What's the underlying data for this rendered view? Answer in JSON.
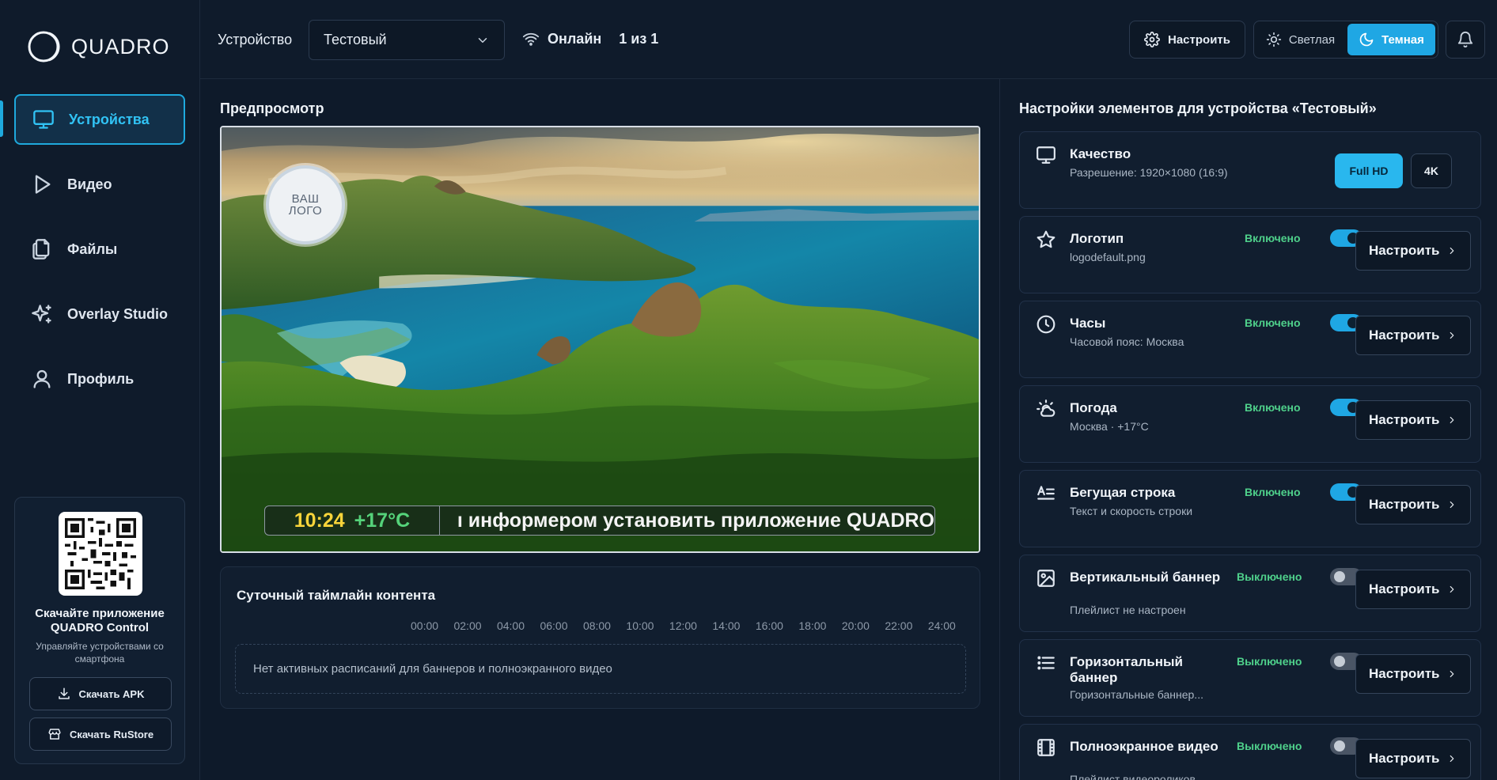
{
  "brand": {
    "name": "QUADRO"
  },
  "sidebar": {
    "items": [
      {
        "label": "Устройства",
        "icon": "monitor-icon",
        "active": true
      },
      {
        "label": "Видео",
        "icon": "play-icon",
        "active": false
      },
      {
        "label": "Файлы",
        "icon": "files-icon",
        "active": false
      },
      {
        "label": "Overlay Studio",
        "icon": "sparkles-icon",
        "active": false
      },
      {
        "label": "Профиль",
        "icon": "user-icon",
        "active": false
      }
    ],
    "app_card": {
      "title": "Скачайте приложение QUADRO Control",
      "subtitle": "Управляйте устройствами со смартфона",
      "apk_label": "Скачать APK",
      "rustore_label": "Скачать RuStore"
    }
  },
  "header": {
    "device_label": "Устройство",
    "device_value": "Тестовый",
    "status": "Онлайн",
    "count": "1 из 1",
    "settings_label": "Настроить",
    "theme_light": "Светлая",
    "theme_dark": "Темная",
    "theme_selected": "Темная"
  },
  "preview": {
    "title": "Предпросмотр",
    "logo_line1": "ВАШ",
    "logo_line2": "ЛОГО",
    "time": "10:24",
    "weather": "+17°C",
    "ticker": "ı информером установить приложение QUADRO"
  },
  "timeline": {
    "title": "Суточный таймлайн контента",
    "ticks": [
      "00:00",
      "02:00",
      "04:00",
      "06:00",
      "08:00",
      "10:00",
      "12:00",
      "14:00",
      "16:00",
      "18:00",
      "20:00",
      "22:00",
      "24:00"
    ],
    "empty": "Нет активных расписаний для баннеров и полноэкранного видео"
  },
  "panel": {
    "title": "Настройки элементов для устройства «Тестовый»",
    "quality": {
      "title": "Качество",
      "subtitle": "Разрешение: 1920×1080 (16:9)",
      "options": [
        "Full HD",
        "4K"
      ],
      "selected": "Full HD"
    },
    "configure_label": "Настроить",
    "items": [
      {
        "title": "Логотип",
        "subtitle": "logodefault.png",
        "state": "Включено",
        "enabled": true,
        "icon": "star-icon"
      },
      {
        "title": "Часы",
        "subtitle": "Часовой пояс: Москва",
        "state": "Включено",
        "enabled": true,
        "icon": "clock-icon"
      },
      {
        "title": "Погода",
        "subtitle": "Москва · +17°C",
        "state": "Включено",
        "enabled": true,
        "icon": "weather-icon"
      },
      {
        "title": "Бегущая строка",
        "subtitle": "Текст и скорость строки",
        "state": "Включено",
        "enabled": true,
        "icon": "text-icon"
      },
      {
        "title": "Вертикальный баннер",
        "subtitle": "Плейлист не настроен",
        "state": "Выключено",
        "enabled": false,
        "icon": "image-icon"
      },
      {
        "title": "Горизонтальный баннер",
        "subtitle": "Горизонтальные баннер...",
        "state": "Выключено",
        "enabled": false,
        "icon": "list-icon"
      },
      {
        "title": "Полноэкранное видео",
        "subtitle": "Плейлист видеороликов",
        "state": "Выключено",
        "enabled": false,
        "icon": "film-icon"
      }
    ]
  },
  "colors": {
    "accent": "#1fa7e4",
    "enabled_text": "#4fd18b",
    "background": "#0e1a2a"
  }
}
